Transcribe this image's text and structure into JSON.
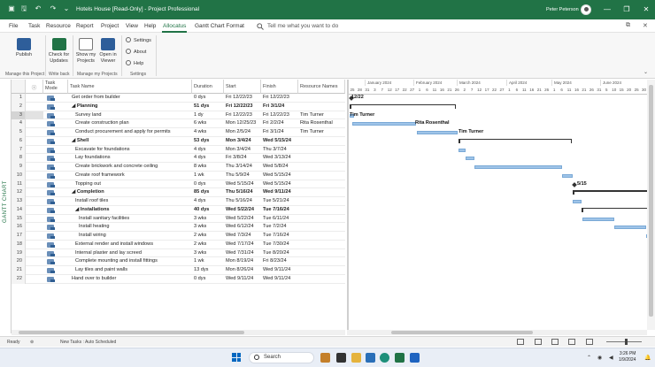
{
  "window": {
    "title": "Hotels House [Read-Only] - Project Professional",
    "user": "Peter Peterson",
    "controls": [
      "—",
      "❐",
      "✕"
    ]
  },
  "menu": {
    "items": [
      "File",
      "Task",
      "Resource",
      "Report",
      "Project",
      "View",
      "Help",
      "Allocatus",
      "Gantt Chart Format"
    ],
    "active_index": 7,
    "tell_me": "Tell me what you want to do"
  },
  "ribbon": {
    "publish": "Publish",
    "check_for_updates": "Check for Updates",
    "show_my_projects": "Show my Projects",
    "open_in_viewer": "Open in Viewer",
    "settings": "Settings",
    "about": "About",
    "help": "Help",
    "groups": [
      "Manage this Project",
      "Write back",
      "Manage my Projects",
      "Settings"
    ]
  },
  "sidebar": {
    "label": "GANTT CHART"
  },
  "grid": {
    "headers": {
      "info": "ⓘ",
      "mode": "Task Mode",
      "name": "Task Name",
      "duration": "Duration",
      "start": "Start",
      "finish": "Finish",
      "resource": "Resource Names"
    },
    "rows": [
      {
        "id": "1",
        "name": "Get order from builder",
        "duration": "0 dys",
        "start": "Fri 12/22/23",
        "finish": "Fri 12/22/23",
        "resource": "",
        "summary": false,
        "indent": 0,
        "selected": false
      },
      {
        "id": "2",
        "name": "◢ Planning",
        "duration": "51 dys",
        "start": "Fri 12/22/23",
        "finish": "Fri 3/1/24",
        "resource": "",
        "summary": true,
        "indent": 0,
        "selected": false
      },
      {
        "id": "3",
        "name": "Survey land",
        "duration": "1 dy",
        "start": "Fri 12/22/23",
        "finish": "Fri 12/22/23",
        "resource": "Tim Turner",
        "summary": false,
        "indent": 1,
        "selected": true
      },
      {
        "id": "4",
        "name": "Create construction plan",
        "duration": "6 wks",
        "start": "Mon 12/25/23",
        "finish": "Fri 2/2/24",
        "resource": "Rita Rosenthal",
        "summary": false,
        "indent": 1,
        "selected": false
      },
      {
        "id": "5",
        "name": "Conduct procurement and apply for permits",
        "duration": "4 wks",
        "start": "Mon 2/5/24",
        "finish": "Fri 3/1/24",
        "resource": "Tim Turner",
        "summary": false,
        "indent": 1,
        "selected": false
      },
      {
        "id": "6",
        "name": "◢ Shell",
        "duration": "53 dys",
        "start": "Mon 3/4/24",
        "finish": "Wed 5/15/24",
        "resource": "",
        "summary": true,
        "indent": 0,
        "selected": false
      },
      {
        "id": "7",
        "name": "Excavate for foundations",
        "duration": "4 dys",
        "start": "Mon 3/4/24",
        "finish": "Thu 3/7/24",
        "resource": "",
        "summary": false,
        "indent": 1,
        "selected": false
      },
      {
        "id": "8",
        "name": "Lay foundations",
        "duration": "4 dys",
        "start": "Fri 3/8/24",
        "finish": "Wed 3/13/24",
        "resource": "",
        "summary": false,
        "indent": 1,
        "selected": false
      },
      {
        "id": "9",
        "name": "Create brickwork and concrete ceiling",
        "duration": "8 wks",
        "start": "Thu 3/14/24",
        "finish": "Wed 5/8/24",
        "resource": "",
        "summary": false,
        "indent": 1,
        "selected": false
      },
      {
        "id": "10",
        "name": "Create roof framework",
        "duration": "1 wk",
        "start": "Thu 5/9/24",
        "finish": "Wed 5/15/24",
        "resource": "",
        "summary": false,
        "indent": 1,
        "selected": false
      },
      {
        "id": "11",
        "name": "Topping out",
        "duration": "0 dys",
        "start": "Wed 5/15/24",
        "finish": "Wed 5/15/24",
        "resource": "",
        "summary": false,
        "indent": 1,
        "selected": false
      },
      {
        "id": "12",
        "name": "◢ Completion",
        "duration": "85 dys",
        "start": "Thu 5/16/24",
        "finish": "Wed 9/11/24",
        "resource": "",
        "summary": true,
        "indent": 0,
        "selected": false
      },
      {
        "id": "13",
        "name": "Install roof tiles",
        "duration": "4 dys",
        "start": "Thu 5/16/24",
        "finish": "Tue 5/21/24",
        "resource": "",
        "summary": false,
        "indent": 1,
        "selected": false
      },
      {
        "id": "14",
        "name": "◢ Installations",
        "duration": "40 dys",
        "start": "Wed 5/22/24",
        "finish": "Tue 7/16/24",
        "resource": "",
        "summary": true,
        "indent": 1,
        "selected": false
      },
      {
        "id": "15",
        "name": "Install sanitary facilities",
        "duration": "3 wks",
        "start": "Wed 5/22/24",
        "finish": "Tue 6/11/24",
        "resource": "",
        "summary": false,
        "indent": 2,
        "selected": false
      },
      {
        "id": "16",
        "name": "Install heating",
        "duration": "3 wks",
        "start": "Wed 6/12/24",
        "finish": "Tue 7/2/24",
        "resource": "",
        "summary": false,
        "indent": 2,
        "selected": false
      },
      {
        "id": "17",
        "name": "Install wiring",
        "duration": "2 wks",
        "start": "Wed 7/3/24",
        "finish": "Tue 7/16/24",
        "resource": "",
        "summary": false,
        "indent": 2,
        "selected": false
      },
      {
        "id": "18",
        "name": "External render and install windows",
        "duration": "2 wks",
        "start": "Wed 7/17/24",
        "finish": "Tue 7/30/24",
        "resource": "",
        "summary": false,
        "indent": 1,
        "selected": false
      },
      {
        "id": "19",
        "name": "Internal plaster and lay screed",
        "duration": "3 wks",
        "start": "Wed 7/31/24",
        "finish": "Tue 8/20/24",
        "resource": "",
        "summary": false,
        "indent": 1,
        "selected": false
      },
      {
        "id": "20",
        "name": "Complete mounting and install fittings",
        "duration": "1 wk",
        "start": "Mon 8/19/24",
        "finish": "Fri 8/23/24",
        "resource": "",
        "summary": false,
        "indent": 1,
        "selected": false
      },
      {
        "id": "21",
        "name": "Lay tiles and paint walls",
        "duration": "13 dys",
        "start": "Mon 8/26/24",
        "finish": "Wed 9/11/24",
        "resource": "",
        "summary": false,
        "indent": 1,
        "selected": false
      },
      {
        "id": "22",
        "name": "Hand over to builder",
        "duration": "0 dys",
        "start": "Wed 9/11/24",
        "finish": "Wed 9/11/24",
        "resource": "",
        "summary": false,
        "indent": 0,
        "selected": false
      }
    ]
  },
  "gantt": {
    "months": [
      "January 2024",
      "February 2024",
      "March 2024",
      "April 2024",
      "May 2024",
      "June 2024"
    ],
    "days": [
      "25",
      "28",
      "31",
      "3",
      "7",
      "12",
      "17",
      "22",
      "27",
      "1",
      "6",
      "11",
      "16",
      "21",
      "26",
      "2",
      "7",
      "12",
      "17",
      "22",
      "27",
      "1",
      "6",
      "11",
      "16",
      "21",
      "26",
      "1",
      "6",
      "11",
      "16",
      "21",
      "26",
      "31",
      "5",
      "10",
      "15",
      "20",
      "25",
      "30"
    ],
    "bars": [
      {
        "row": 1,
        "kind": "milestone",
        "label": "12/22"
      },
      {
        "row": 2,
        "kind": "summary"
      },
      {
        "row": 3,
        "kind": "task",
        "label": "Tim Turner"
      },
      {
        "row": 4,
        "kind": "task",
        "label": "Rita Rosenthal"
      },
      {
        "row": 5,
        "kind": "task",
        "label": "Tim Turner"
      },
      {
        "row": 6,
        "kind": "summary"
      },
      {
        "row": 7,
        "kind": "task"
      },
      {
        "row": 8,
        "kind": "task"
      },
      {
        "row": 9,
        "kind": "task"
      },
      {
        "row": 10,
        "kind": "task"
      },
      {
        "row": 11,
        "kind": "milestone",
        "label": "5/15"
      },
      {
        "row": 12,
        "kind": "summary"
      },
      {
        "row": 13,
        "kind": "task"
      },
      {
        "row": 14,
        "kind": "summary"
      },
      {
        "row": 15,
        "kind": "task"
      },
      {
        "row": 16,
        "kind": "task"
      },
      {
        "row": 17,
        "kind": "task"
      }
    ]
  },
  "status": {
    "ready": "Ready",
    "new_tasks": "New Tasks : Auto Scheduled"
  },
  "taskbar": {
    "search": "Search",
    "time": "3:26 PM",
    "date": "1/9/2024"
  },
  "colors": {
    "brand": "#217346",
    "bar_fill": "#9fc4e8",
    "bar_border": "#7aa9d6"
  }
}
